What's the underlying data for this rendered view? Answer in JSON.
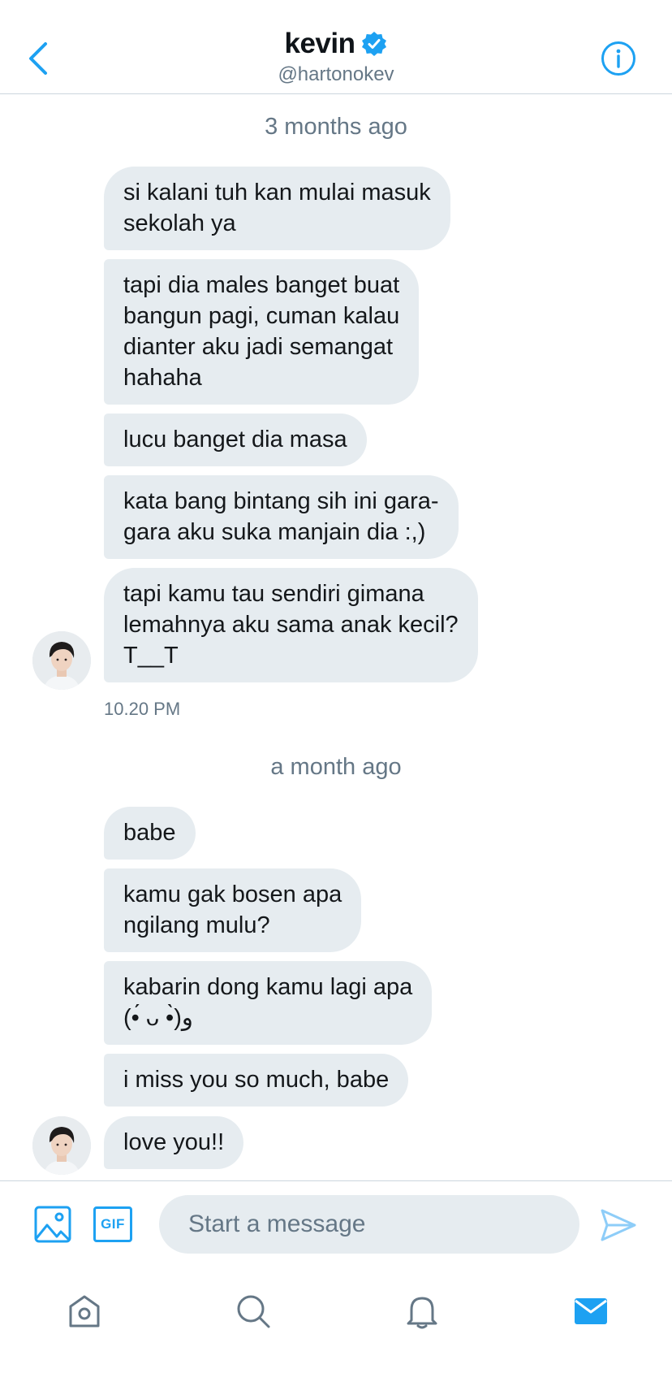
{
  "header": {
    "name": "kevin",
    "handle": "@hartonokev",
    "verified_icon": "verified-badge-icon",
    "back_icon": "chevron-left-icon",
    "info_icon": "info-icon"
  },
  "conversation": {
    "groups": [
      {
        "divider": "3 months ago",
        "messages": [
          "si kalani tuh kan mulai masuk\nsekolah ya",
          "tapi dia males banget buat\nbangun pagi, cuman kalau\ndianter aku jadi semangat\nhahaha",
          "lucu banget dia masa",
          "kata bang bintang sih ini gara-\ngara aku suka manjain dia :,)",
          "tapi kamu tau sendiri gimana\nlemahnya aku sama anak kecil?\nT__T"
        ],
        "time": "10.20 PM"
      },
      {
        "divider": "a month ago",
        "messages": [
          "babe",
          "kamu gak bosen apa\nngilang mulu?",
          "kabarin dong kamu lagi apa\n(•́ ᴗ •̀)و",
          "i miss you so much, babe",
          "love you!!"
        ]
      }
    ]
  },
  "composer": {
    "placeholder": "Start a message",
    "gif_label": "GIF",
    "image_icon": "image-icon",
    "send_icon": "send-icon"
  },
  "tabbar": {
    "items": [
      "home-icon",
      "search-icon",
      "notifications-icon",
      "messages-icon"
    ],
    "active": "messages-icon"
  },
  "colors": {
    "accent": "#1da1f2",
    "bubble": "#e6ecf0",
    "secondary_text": "#657786"
  }
}
